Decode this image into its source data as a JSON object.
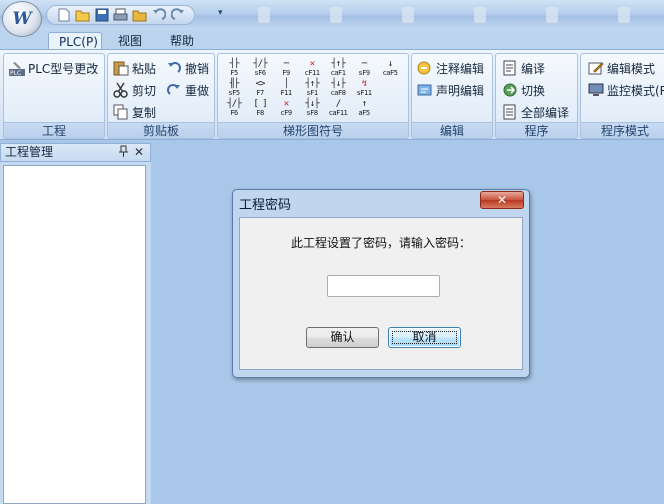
{
  "qat": {
    "icons": [
      "new-file-icon",
      "open-folder-icon",
      "save-icon",
      "print-icon",
      "folder-icon",
      "undo-icon",
      "redo-icon"
    ],
    "more": "▾"
  },
  "menu_tabs": [
    {
      "label": "PLC(P)",
      "active": true
    },
    {
      "label": "视图",
      "active": false
    },
    {
      "label": "帮助",
      "active": false
    }
  ],
  "ribbon": {
    "project": {
      "label": "工程",
      "plc_change": "PLC型号更改",
      "plc_icon_text": "PLC"
    },
    "clipboard": {
      "label": "剪贴板",
      "paste": "粘贴",
      "cut": "剪切",
      "copy": "复制",
      "undo": "撤销",
      "redo": "重做"
    },
    "ladder": {
      "label": "梯形图符号",
      "row1": [
        {
          "sym": "┤├",
          "sub": "F5"
        },
        {
          "sym": "┤/├",
          "sub": "sF6"
        },
        {
          "sym": "─",
          "sub": "F9"
        },
        {
          "sym": "✕",
          "sub": "cF11",
          "red": true
        },
        {
          "sym": "┤↑├",
          "sub": "caF1"
        },
        {
          "sym": "─",
          "sub": "sF9"
        },
        {
          "sym": "↓",
          "sub": "caF5"
        }
      ],
      "row2": [
        {
          "sym": "╢├",
          "sub": "sF5"
        },
        {
          "sym": "<>",
          "sub": "F7"
        },
        {
          "sym": "│",
          "sub": "F11"
        },
        {
          "sym": "┤↑├",
          "sub": "sF1"
        },
        {
          "sym": "┤↓├",
          "sub": "caF8"
        },
        {
          "sym": "↯",
          "sub": "sF11",
          "red": true
        }
      ],
      "row3": [
        {
          "sym": "┤/├",
          "sub": "F6"
        },
        {
          "sym": "[ ]",
          "sub": "F8"
        },
        {
          "sym": "✕",
          "sub": "cF9",
          "red": true
        },
        {
          "sym": "┤↓├",
          "sub": "sF8"
        },
        {
          "sym": "/",
          "sub": "caF11"
        },
        {
          "sym": "↑",
          "sub": "aF5"
        }
      ]
    },
    "edit": {
      "label": "编辑",
      "comment_edit": "注释编辑",
      "statement_edit": "声明编辑"
    },
    "program": {
      "label": "程序",
      "compile": "编译",
      "switch": "切换",
      "compile_all": "全部编译"
    },
    "mode": {
      "label": "程序模式",
      "edit_mode": "编辑模式",
      "monitor_mode": "监控模式(R"
    }
  },
  "panel": {
    "title": "工程管理",
    "pin": "ㅁ",
    "close": "✕"
  },
  "dialog": {
    "title": "工程密码",
    "close": "✕",
    "prompt": "此工程设置了密码，请输入密码：",
    "password_value": "",
    "ok": "确认",
    "cancel": "取消"
  },
  "colors": {
    "workspace": "#a9c7e8",
    "ribbon_border": "#8eaed6",
    "close_red": "#c8523c"
  }
}
